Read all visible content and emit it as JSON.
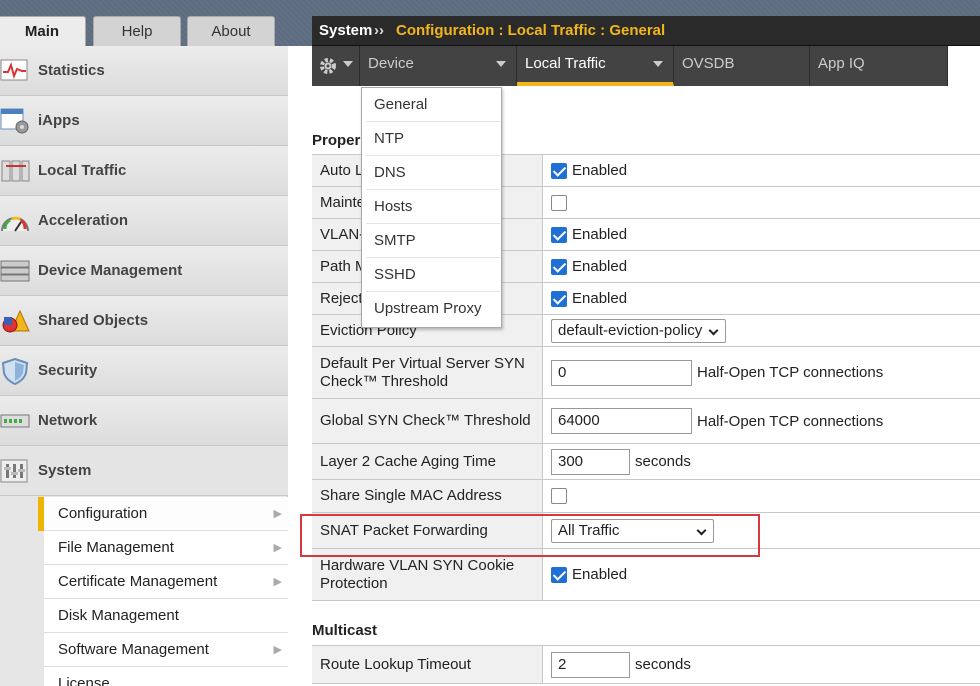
{
  "left_tabs": [
    "Main",
    "Help",
    "About"
  ],
  "nav": {
    "items": [
      {
        "label": "Statistics",
        "icon": "statistics-icon"
      },
      {
        "label": "iApps",
        "icon": "iapps-icon"
      },
      {
        "label": "Local Traffic",
        "icon": "local-traffic-icon"
      },
      {
        "label": "Acceleration",
        "icon": "acceleration-icon"
      },
      {
        "label": "Device Management",
        "icon": "device-management-icon"
      },
      {
        "label": "Shared Objects",
        "icon": "shared-objects-icon"
      },
      {
        "label": "Security",
        "icon": "security-icon"
      },
      {
        "label": "Network",
        "icon": "network-icon"
      },
      {
        "label": "System",
        "icon": "system-icon"
      }
    ],
    "sub_items": [
      "Configuration",
      "File Management",
      "Certificate Management",
      "Disk Management",
      "Software Management",
      "License"
    ]
  },
  "header": {
    "system": "System",
    "separator": "››",
    "path": "Configuration : Local Traffic : General"
  },
  "menubar": {
    "tabs": [
      "Device",
      "Local Traffic",
      "OVSDB",
      "App IQ"
    ]
  },
  "dropdown": {
    "items": [
      "General",
      "NTP",
      "DNS",
      "Hosts",
      "SMTP",
      "SSHD",
      "Upstream Proxy"
    ]
  },
  "properties": {
    "title": "Proper",
    "rows": {
      "auto": {
        "label": "Auto L",
        "value": "Enabled",
        "checked": true
      },
      "maint": {
        "label": "Mainte",
        "checked": false
      },
      "vlan": {
        "label": "VLAN-",
        "value": "Enabled",
        "checked": true
      },
      "path": {
        "label": "Path M",
        "value": "Enabled",
        "checked": true
      },
      "reject": {
        "label": "Reject",
        "value": "Enabled",
        "checked": true
      },
      "eviction": {
        "label": "Eviction Policy",
        "value": "default-eviction-policy"
      },
      "default_syn": {
        "label": "Default Per Virtual Server SYN Check™ Threshold",
        "value": "0",
        "suffix": "Half-Open TCP connections"
      },
      "global_syn": {
        "label": "Global SYN Check™ Threshold",
        "value": "64000",
        "suffix": "Half-Open TCP connections"
      },
      "l2cache": {
        "label": "Layer 2 Cache Aging Time",
        "value": "300",
        "suffix": "seconds"
      },
      "share_mac": {
        "label": "Share Single MAC Address",
        "checked": false
      },
      "snat": {
        "label": "SNAT Packet Forwarding",
        "value": "All Traffic"
      },
      "hw_vlan": {
        "label": "Hardware VLAN SYN Cookie Protection",
        "value": "Enabled",
        "checked": true
      }
    }
  },
  "multicast": {
    "title": "Multicast",
    "route_lookup": {
      "label": "Route Lookup Timeout",
      "value": "2",
      "suffix": "seconds"
    }
  },
  "colors": {
    "accent": "#f2b51c",
    "checkbox": "#1e6fd6",
    "highlight": "#d9373e"
  }
}
